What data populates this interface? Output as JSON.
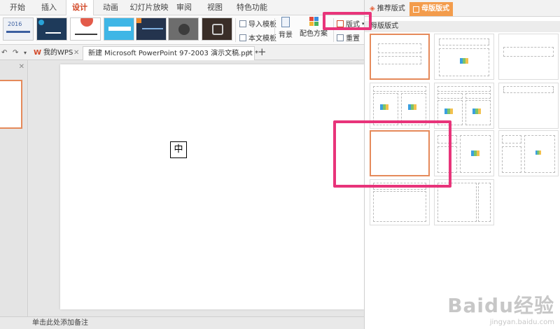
{
  "menu": {
    "tabs": [
      "开始",
      "插入",
      "设计",
      "动画",
      "幻灯片放映",
      "审阅",
      "视图",
      "特色功能"
    ],
    "active_index": 2
  },
  "ribbon": {
    "import_template": "导入模板",
    "body_template": "本文模板",
    "background": "背景",
    "color_scheme": "配色方案",
    "layout_button": "版式",
    "reset": "重置",
    "theme_year": "2016"
  },
  "doctabs": {
    "home": "我的WPS",
    "file": "新建 Microsoft PowerPoint 97-2003 演示文稿.ppt *"
  },
  "canvas": {
    "ime_char": "中"
  },
  "notes": {
    "placeholder": "单击此处添加备注"
  },
  "panel": {
    "tab_recommended": "推荐版式",
    "tab_master": "母版版式",
    "section_title": "母版版式"
  },
  "watermark": {
    "brand": "Baidu经验",
    "url": "jingyan.baidu.com"
  },
  "colors": {
    "accent": "#d24726",
    "panel_accent": "#f39c4c",
    "highlight": "#e8347a",
    "selection": "#e58a5a"
  }
}
